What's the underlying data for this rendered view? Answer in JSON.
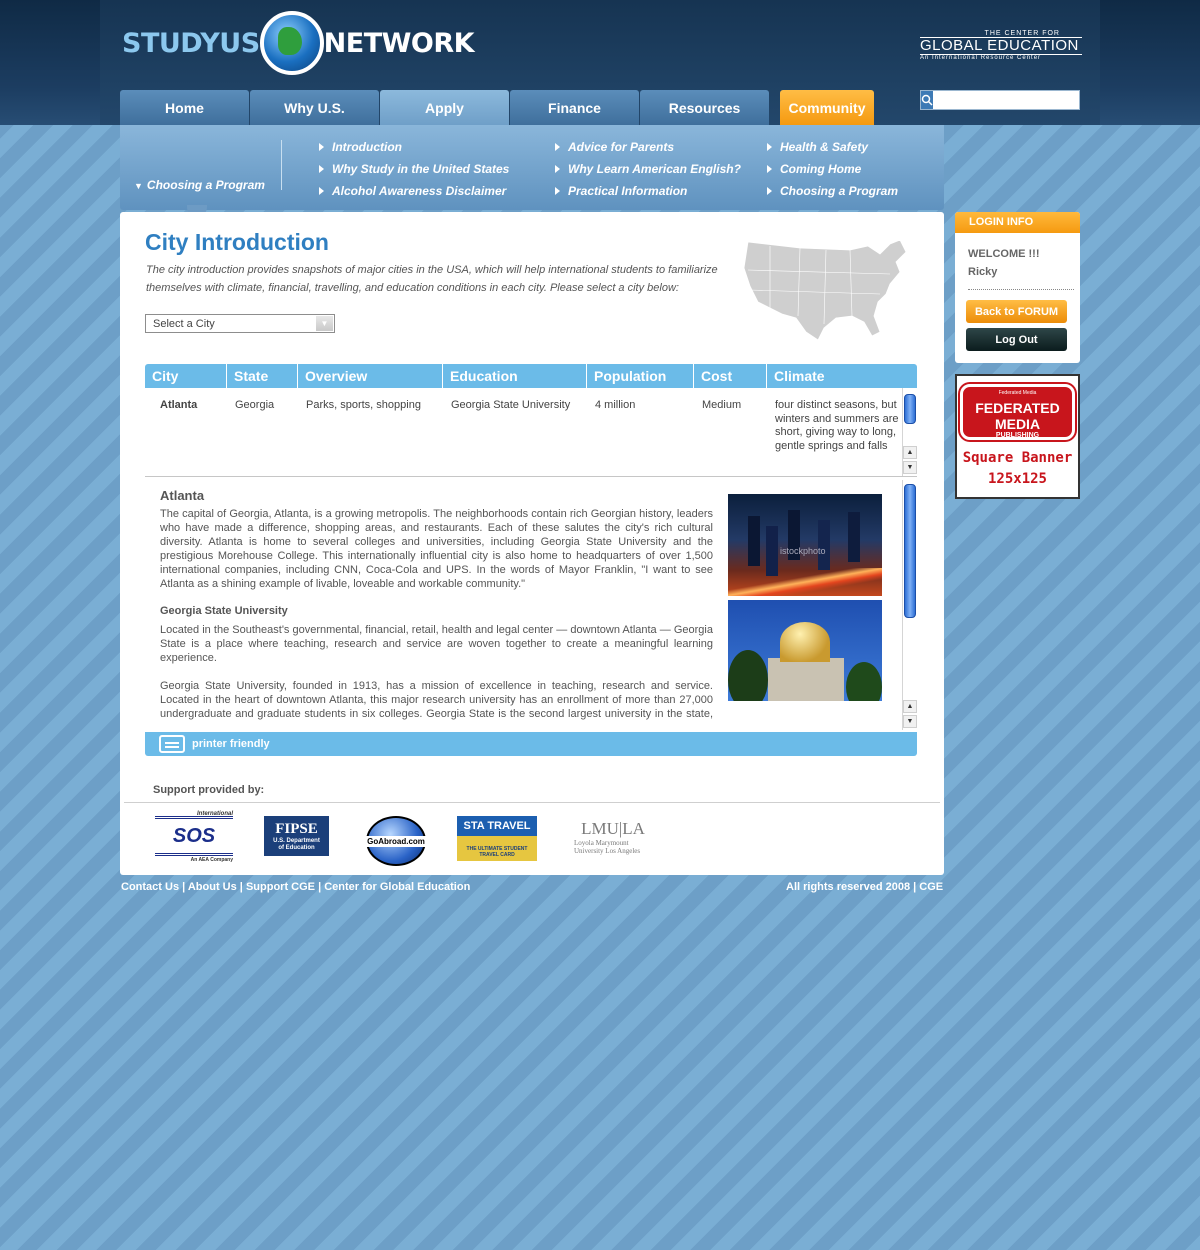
{
  "site": {
    "logo_study": "STUDYUS",
    "logo_network": "NETWORK",
    "partner_line1": "THE CENTER FOR",
    "partner_line2": "GLOBAL EDUCATION",
    "partner_line3": "An International Resource Center"
  },
  "nav": {
    "tabs": [
      {
        "label": "Home"
      },
      {
        "label": "Why U.S."
      },
      {
        "label": "Apply"
      },
      {
        "label": "Finance"
      },
      {
        "label": "Resources"
      },
      {
        "label": "Community"
      }
    ],
    "active_tab": "Apply",
    "search_value": ""
  },
  "subnav": {
    "current": "Choosing a Program",
    "col1": [
      "Introduction",
      "Why Study in the United States",
      "Alcohol Awareness Disclaimer"
    ],
    "col2": [
      "Advice for Parents",
      "Why Learn American English?",
      "Practical Information"
    ],
    "col3": [
      "Health & Safety",
      "Coming Home",
      "Choosing a Program"
    ]
  },
  "main": {
    "title": "City Introduction",
    "intro": "The city introduction provides snapshots of major cities in the USA, which will help international students to familiarize themselves with climate, financial, travelling, and education conditions in each city. Please select a city below:",
    "select_value": "Select a City"
  },
  "table": {
    "headers": [
      "City",
      "State",
      "Overview",
      "Education",
      "Population",
      "Cost",
      "Climate"
    ],
    "row": {
      "city": "Atlanta",
      "state": "Georgia",
      "overview": "Parks, sports, shopping",
      "education": "Georgia State University",
      "population": "4 million",
      "cost": "Medium",
      "climate": "four distinct seasons, but winters and summers are short, giving way to long, gentle springs and falls"
    }
  },
  "detail": {
    "city_title": "Atlanta",
    "city_text": "The capital of Georgia, Atlanta, is a growing metropolis. The neighborhoods contain rich Georgian history, leaders who have made a difference, shopping areas, and restaurants. Each of these salutes the city's rich cultural diversity. Atlanta is home to several colleges and universities, including Georgia State University and the prestigious Morehouse College. This internationally influential city is also home to headquarters of over 1,500 international companies, including CNN, Coca-Cola and UPS. In the words of Mayor Franklin, \"I want to see Atlanta as a shining example of livable, loveable and workable community.\"",
    "uni_title": "Georgia State University",
    "uni_text1": "Located in the Southeast's governmental, financial, retail, health and legal center — downtown Atlanta — Georgia State is a place where teaching, research and service are woven together to create a meaningful learning experience.",
    "uni_text2": "Georgia State University, founded in 1913, has a mission of excellence in teaching, research and service. Located in the heart of downtown Atlanta, this major research university has an enrollment of more than 27,000 undergraduate and graduate students in six colleges. Georgia State is the second largest university in the state, with students",
    "photo_watermark": "istockphoto"
  },
  "print_label": "printer friendly",
  "support": {
    "label": "Support provided by:",
    "sponsors": {
      "sos": "SOS",
      "sos_top": "International",
      "sos_sub": "An AEA Company",
      "fipse": "FIPSE",
      "fipse_sub": "U.S. Department of Education",
      "goabroad": "GoAbroad.com",
      "sta": "STA TRAVEL",
      "sta_sub": "THE ULTIMATE STUDENT TRAVEL CARD",
      "lmu": "LMU|LA",
      "lmu_sub": "Loyola Marymount University Los Angeles"
    }
  },
  "footer": {
    "links": [
      "Contact Us",
      "About Us",
      "Support CGE",
      "Center for Global Education"
    ],
    "rights": "All rights reserved 2008 | CGE"
  },
  "login": {
    "header": "LOGIN INFO",
    "welcome": "WELCOME !!!",
    "user": "Ricky",
    "forum_button": "Back to FORUM",
    "logout_button": "Log Out"
  },
  "banner": {
    "top": "Federated Media",
    "brand": "FEDERATED MEDIA",
    "sub": "PUBLISHING",
    "line1": "Square Banner",
    "line2": "125x125"
  },
  "colors": {
    "accent_blue": "#2f7fc1",
    "table_header": "#6bbbe8",
    "orange": "#f59a10"
  }
}
